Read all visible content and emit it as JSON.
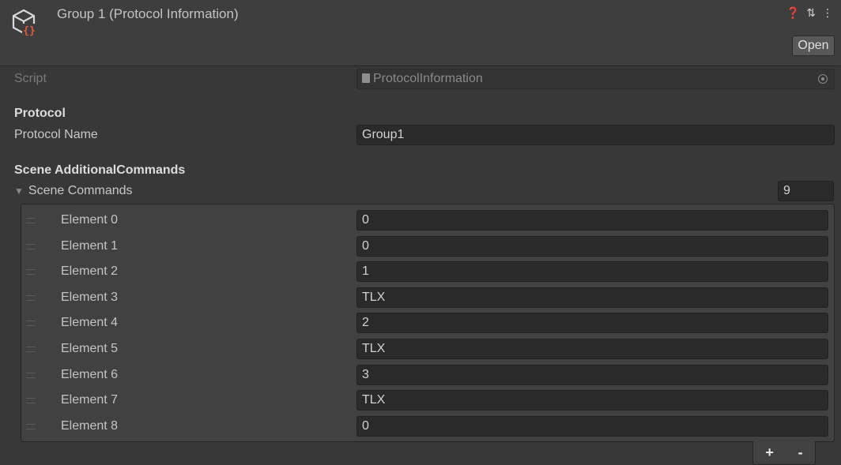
{
  "header": {
    "title": "Group 1 (Protocol Information)",
    "open_label": "Open",
    "icons": [
      "help-icon",
      "presets-icon",
      "more-icon"
    ],
    "asset_icon": "scriptable-object-icon"
  },
  "script": {
    "label": "Script",
    "value": "ProtocolInformation"
  },
  "protocol": {
    "section": "Protocol",
    "name_label": "Protocol Name",
    "name_value": "Group1"
  },
  "scene": {
    "section": "Scene AdditionalCommands",
    "list_label": "Scene Commands",
    "size": "9",
    "elements": [
      {
        "label": "Element 0",
        "value": "0"
      },
      {
        "label": "Element 1",
        "value": "0"
      },
      {
        "label": "Element 2",
        "value": "1"
      },
      {
        "label": "Element 3",
        "value": "TLX"
      },
      {
        "label": "Element 4",
        "value": "2"
      },
      {
        "label": "Element 5",
        "value": "TLX"
      },
      {
        "label": "Element 6",
        "value": "3"
      },
      {
        "label": "Element 7",
        "value": "TLX"
      },
      {
        "label": "Element 8",
        "value": "0"
      }
    ],
    "add_label": "+",
    "remove_label": "-"
  },
  "colors": {
    "background": "#383838",
    "header": "#3e3e3e",
    "field": "#2a2a2a",
    "icon_accent": "#e8583c"
  }
}
